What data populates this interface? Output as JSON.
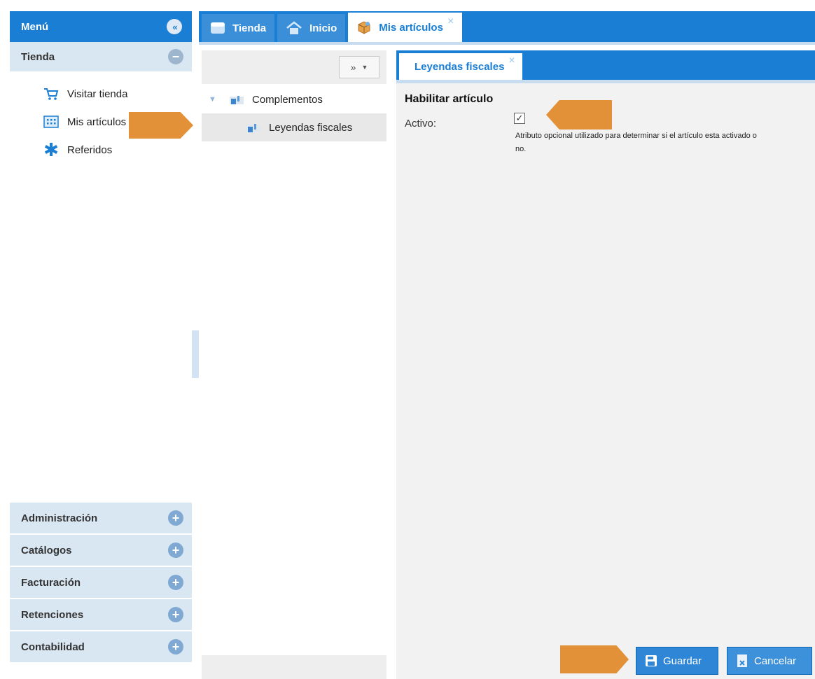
{
  "menu": {
    "title": "Menú",
    "sections": {
      "tienda": {
        "label": "Tienda",
        "items": [
          {
            "label": "Visitar tienda",
            "icon": "cart-icon"
          },
          {
            "label": "Mis artículos",
            "icon": "grid-icon"
          },
          {
            "label": "Referidos",
            "icon": "asterisk-icon"
          }
        ]
      },
      "collapsed": [
        {
          "label": "Administración"
        },
        {
          "label": "Catálogos"
        },
        {
          "label": "Facturación"
        },
        {
          "label": "Retenciones"
        },
        {
          "label": "Contabilidad"
        }
      ]
    }
  },
  "tabs": [
    {
      "label": "Tienda",
      "icon": "store-icon",
      "active": false
    },
    {
      "label": "Inicio",
      "icon": "home-icon",
      "active": false
    },
    {
      "label": "Mis artículos",
      "icon": "box-icon",
      "active": true,
      "close": "×"
    }
  ],
  "tree": {
    "toolbar_label": "»",
    "nodes": [
      {
        "label": "Complementos",
        "level": 0,
        "expanded": true
      },
      {
        "label": "Leyendas fiscales",
        "level": 1,
        "selected": true
      }
    ]
  },
  "content": {
    "tab": {
      "label": "Leyendas fiscales",
      "close": "×"
    },
    "section_title": "Habilitar artículo",
    "field": {
      "label": "Activo:",
      "checked": true,
      "hint": "Atributo opcional utilizado para determinar si el artículo esta activado o no."
    },
    "buttons": {
      "save": "Guardar",
      "cancel": "Cancelar"
    }
  },
  "colors": {
    "accent": "#1a7ed4",
    "callout": "#e39138"
  }
}
